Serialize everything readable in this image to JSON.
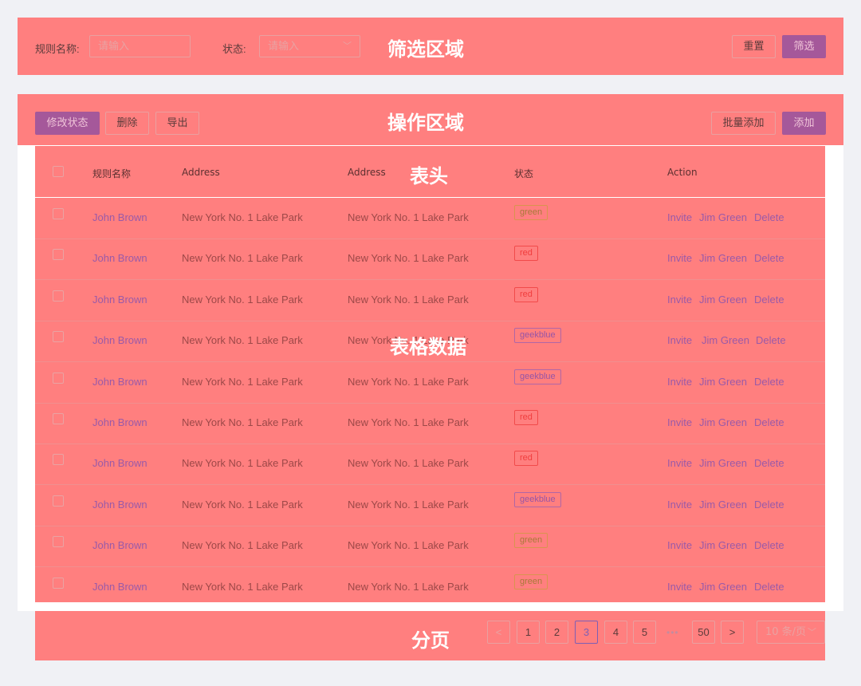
{
  "filter": {
    "region_label": "筛选区域",
    "rule_name_label": "规则名称:",
    "rule_name_placeholder": "请输入",
    "status_label": "状态:",
    "status_placeholder": "请输入",
    "reset_label": "重置",
    "filter_label": "筛选"
  },
  "ops": {
    "region_label": "操作区域",
    "modify_status_label": "修改状态",
    "delete_label": "删除",
    "export_label": "导出",
    "batch_add_label": "批量添加",
    "add_label": "添加"
  },
  "table": {
    "header_label": "表头",
    "data_label": "表格数据",
    "columns": [
      "规则名称",
      "Address",
      "Address",
      "状态",
      "Action"
    ],
    "rows": [
      {
        "name": "John Brown",
        "addr1": "New York No. 1 Lake Park",
        "addr2": "New York No. 1 Lake Park",
        "tag": "green",
        "a1": "Invite",
        "a2": "Jim Green",
        "a3": "Delete"
      },
      {
        "name": "John Brown",
        "addr1": "New York No. 1 Lake Park",
        "addr2": "New York No. 1 Lake Park",
        "tag": "red",
        "a1": "Invite",
        "a2": "Jim Green",
        "a3": "Delete"
      },
      {
        "name": "John Brown",
        "addr1": "New York No. 1 Lake Park",
        "addr2": "New York No. 1 Lake Park",
        "tag": "red",
        "a1": "Invite",
        "a2": "Jim Green",
        "a3": "Delete"
      },
      {
        "name": "John Brown",
        "addr1": "New York No. 1 Lake Park",
        "addr2": "New York No. 1 Lake Park",
        "tag": "geekblue",
        "a1": "Invite",
        "a2": "Jim Green",
        "a3": "Delete"
      },
      {
        "name": "John Brown",
        "addr1": "New York No. 1 Lake Park",
        "addr2": "New York No. 1 Lake Park",
        "tag": "geekblue",
        "a1": "Invite",
        "a2": "Jim Green",
        "a3": "Delete"
      },
      {
        "name": "John Brown",
        "addr1": "New York No. 1 Lake Park",
        "addr2": "New York No. 1 Lake Park",
        "tag": "red",
        "a1": "Invite",
        "a2": "Jim Green",
        "a3": "Delete"
      },
      {
        "name": "John Brown",
        "addr1": "New York No. 1 Lake Park",
        "addr2": "New York No. 1 Lake Park",
        "tag": "red",
        "a1": "Invite",
        "a2": "Jim Green",
        "a3": "Delete"
      },
      {
        "name": "John Brown",
        "addr1": "New York No. 1 Lake Park",
        "addr2": "New York No. 1 Lake Park",
        "tag": "geekblue",
        "a1": "Invite",
        "a2": "Jim Green",
        "a3": "Delete"
      },
      {
        "name": "John Brown",
        "addr1": "New York No. 1 Lake Park",
        "addr2": "New York No. 1 Lake Park",
        "tag": "green",
        "a1": "Invite",
        "a2": "Jim Green",
        "a3": "Delete"
      },
      {
        "name": "John Brown",
        "addr1": "New York No. 1 Lake Park",
        "addr2": "New York No. 1 Lake Park",
        "tag": "green",
        "a1": "Invite",
        "a2": "Jim Green",
        "a3": "Delete"
      }
    ]
  },
  "pagination": {
    "region_label": "分页",
    "prev_icon": "chevron-left-icon",
    "next_icon": "chevron-right-icon",
    "pages": [
      "1",
      "2",
      "3",
      "4",
      "5"
    ],
    "active_page": "3",
    "ellipsis": "•••",
    "last_page": "50",
    "page_size": "10 条/页"
  },
  "colors": {
    "overlay": "#ff7f7f",
    "primary": "#a5589a",
    "page_bg": "#f0f1f5",
    "link": "#9a5aa8"
  }
}
